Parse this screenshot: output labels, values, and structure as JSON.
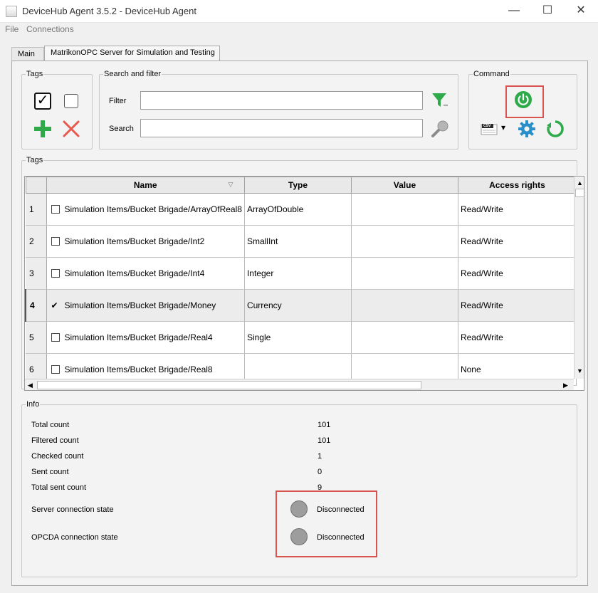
{
  "window": {
    "title": "DeviceHub Agent 3.5.2 - DeviceHub Agent",
    "minimize_glyph": "—",
    "maximize_glyph": "☐",
    "close_glyph": "✕"
  },
  "menu": {
    "items": [
      "File",
      "Connections"
    ]
  },
  "tabs": [
    {
      "label": "Main",
      "active": false
    },
    {
      "label": "MatrikonOPC Server for Simulation and Testing",
      "active": true
    }
  ],
  "tags_group": {
    "legend": "Tags",
    "check_all_glyph": "✓",
    "add_glyph": "+",
    "remove_glyph": "✕"
  },
  "search_group": {
    "legend": "Search and filter",
    "filter_label": "Filter",
    "filter_value": "",
    "search_label": "Search",
    "search_value": ""
  },
  "command_group": {
    "legend": "Command",
    "csv_label": "CSV",
    "dropdown_glyph": "▾"
  },
  "table_group": {
    "legend": "Tags",
    "columns": [
      "Name",
      "Type",
      "Value",
      "Access rights"
    ],
    "rows": [
      {
        "num": "1",
        "checked": false,
        "name": "Simulation Items/Bucket Brigade/ArrayOfReal8",
        "type": "ArrayOfDouble",
        "value": "",
        "access": "Read/Write"
      },
      {
        "num": "2",
        "checked": false,
        "name": "Simulation Items/Bucket Brigade/Int2",
        "type": "SmallInt",
        "value": "",
        "access": "Read/Write"
      },
      {
        "num": "3",
        "checked": false,
        "name": "Simulation Items/Bucket Brigade/Int4",
        "type": "Integer",
        "value": "",
        "access": "Read/Write"
      },
      {
        "num": "4",
        "checked": true,
        "name": "Simulation Items/Bucket Brigade/Money",
        "type": "Currency",
        "value": "",
        "access": "Read/Write"
      },
      {
        "num": "5",
        "checked": false,
        "name": "Simulation Items/Bucket Brigade/Real4",
        "type": "Single",
        "value": "",
        "access": "Read/Write"
      },
      {
        "num": "6",
        "checked": false,
        "name": "Simulation Items/Bucket Brigade/Real8",
        "type": "",
        "value": "",
        "access": "None"
      }
    ],
    "check_glyph": "✔",
    "sort_glyph": "▽",
    "scroll_up": "▲",
    "scroll_down": "▼",
    "scroll_left": "◀",
    "scroll_right": "▶"
  },
  "info_group": {
    "legend": "Info",
    "rows": [
      {
        "label": "Total count",
        "value": "101"
      },
      {
        "label": "Filtered count",
        "value": "101"
      },
      {
        "label": "Checked count",
        "value": "1"
      },
      {
        "label": "Sent count",
        "value": "0"
      },
      {
        "label": "Total sent count",
        "value": "9"
      }
    ],
    "server_state_label": "Server connection state",
    "server_state_value": "Disconnected",
    "opcda_state_label": "OPCDA connection state",
    "opcda_state_value": "Disconnected"
  },
  "colors": {
    "accent_green": "#2eaa4a",
    "remove_red": "#e8584f",
    "highlight_red": "#d9534f",
    "gear_blue": "#2a8fc9",
    "state_gray": "#9d9d9d"
  },
  "icons": {
    "check_all": "checkbox-checked-icon",
    "uncheck_all": "checkbox-empty-icon",
    "add": "plus-icon",
    "remove": "x-icon",
    "filter": "funnel-icon",
    "search": "magnifier-icon",
    "connect": "power-icon",
    "export": "csv-icon",
    "settings": "gear-icon",
    "refresh": "refresh-icon"
  }
}
